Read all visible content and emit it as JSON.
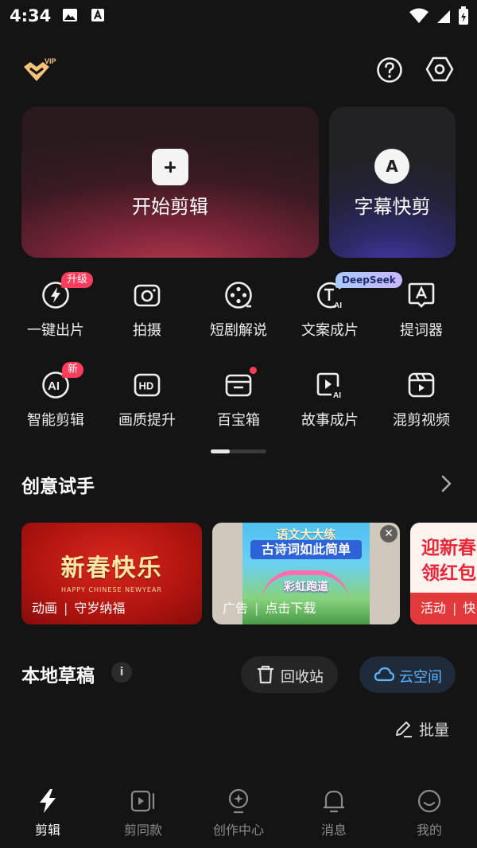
{
  "status_bar": {
    "time": "4:34"
  },
  "hero": {
    "start_edit": "开始剪辑",
    "subtitle_edit": "字幕快剪",
    "subtitle_icon_letter": "A"
  },
  "tools": [
    {
      "label": "一键出片",
      "badge": "升级"
    },
    {
      "label": "拍摄"
    },
    {
      "label": "短剧解说"
    },
    {
      "label": "文案成片",
      "badge": "DeepSeek"
    },
    {
      "label": "提词器"
    },
    {
      "label": "智能剪辑",
      "badge": "新"
    },
    {
      "label": "画质提升"
    },
    {
      "label": "百宝箱"
    },
    {
      "label": "故事成片"
    },
    {
      "label": "混剪视频"
    }
  ],
  "creative": {
    "title": "创意试手",
    "cards": [
      {
        "tag": "动画",
        "name": "守岁纳福",
        "art_title": "新春快乐",
        "art_sub": "HAPPY CHINESE NEWYEAR"
      },
      {
        "tag": "广告",
        "name": "点击下载",
        "art_line1": "语文大大练",
        "art_line2": "古诗词如此简单",
        "art_line3": "彩虹跑道"
      },
      {
        "tag": "活动",
        "name": "快",
        "art_line1": "迎新春",
        "art_line2": "领红包"
      }
    ]
  },
  "drafts": {
    "title": "本地草稿",
    "info": "i",
    "recycle": "回收站",
    "cloud": "云空间",
    "batch": "批量"
  },
  "nav": [
    {
      "label": "剪辑",
      "icon": "lightning-icon",
      "active": true
    },
    {
      "label": "剪同款",
      "icon": "template-icon"
    },
    {
      "label": "创作中心",
      "icon": "bulb-icon"
    },
    {
      "label": "消息",
      "icon": "bell-icon"
    },
    {
      "label": "我的",
      "icon": "smile-icon"
    }
  ],
  "colors": {
    "background": "#141414",
    "badge_red": "#ff3d5d",
    "cloud_blue": "#5cb4ff"
  }
}
